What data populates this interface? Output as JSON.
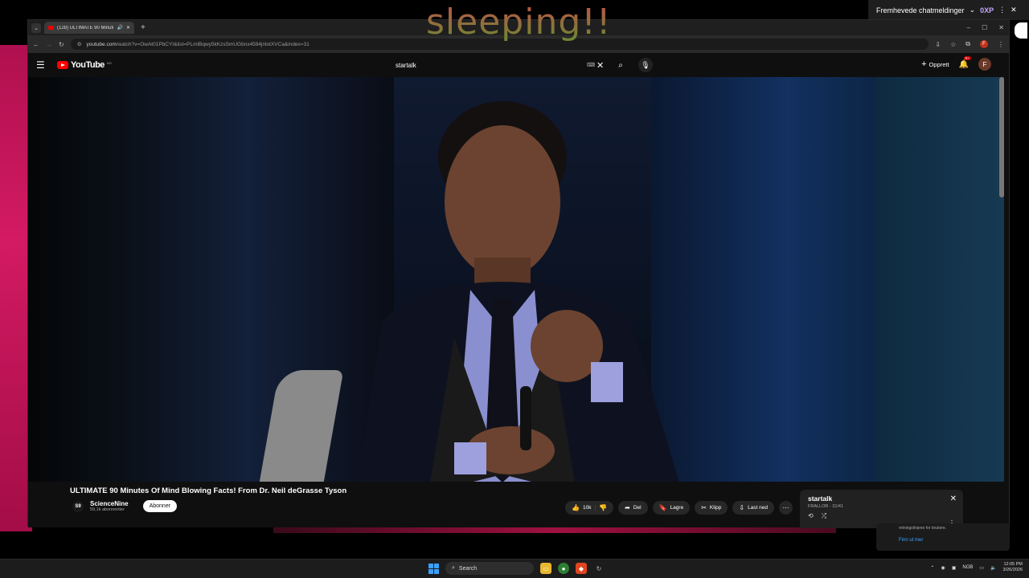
{
  "overlay": {
    "text": "sleeping!!"
  },
  "chat_bar": {
    "label": "Fremhevede chatmeldinger",
    "badge": "0XP"
  },
  "browser": {
    "tab_title": "(128) ULTIMATE 90 Minute",
    "url_domain": "youtube.com",
    "url_rest": "/watch?v=OwAt01PbCYI&list=PLmlBqwy5kKzsSmUGbnx4594jnlotXVCa&index=31"
  },
  "youtube": {
    "logo_text": "YouTube",
    "logo_cc": "NO",
    "search_value": "startalk",
    "create_label": "Opprett",
    "notif_count": "9+",
    "avatar_letter": "F"
  },
  "video": {
    "title": "ULTIMATE 90 Minutes Of Mind Blowing Facts! From Dr. Neil deGrasse Tyson",
    "channel_name": "ScienceNine",
    "channel_subs": "59,1k abonnenter",
    "channel_initials": "S9",
    "subscribe_label": "Abonner",
    "actions": {
      "like_count": "10k",
      "share": "Del",
      "save": "Lagre",
      "clip": "Klipp",
      "download": "Last ned"
    }
  },
  "playlist": {
    "title": "startalk",
    "subtitle": "FRALLOR - 31/41"
  },
  "notice": {
    "text": "retningslinjene for brukere.",
    "link": "Finn ut mer"
  },
  "taskbar": {
    "search_label": "Search",
    "lang": "NOB",
    "time": "12:05 PM",
    "date": "3/26/2026"
  },
  "colors": {
    "youtube_red": "#ff0000",
    "accent_blue": "#3ea6ff",
    "wallpaper": "#d31a63"
  }
}
